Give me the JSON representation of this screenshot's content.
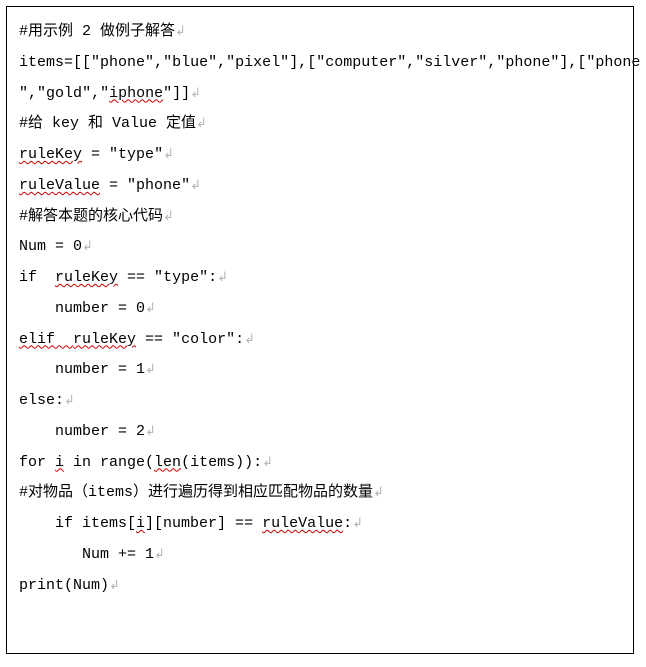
{
  "code": {
    "l1_comment": "#用示例 2 做例子解答",
    "l2_a": "items=[[",
    "l2_q": "\"",
    "l2_phone": "phone",
    "l2_comma": ",",
    "l2_blue": "blue",
    "l2_pixel": "pixel",
    "l2_b": "],[",
    "l2_computer": "computer",
    "l2_silver": "silver",
    "l2_phone2": "phone",
    "l2_c": "],[",
    "l2_phone3": "phone",
    "l3_a": "\"",
    "l3_gold": "gold",
    "l3_iphone": "iphone",
    "l3_b": "]]",
    "l4_comment": "#给 key 和 Value 定值",
    "l5_rk": "ruleKey",
    "l5_eq": " = ",
    "l5_type": "type",
    "l6_rv": "ruleValue",
    "l6_eq": " = ",
    "l6_phone": "phone",
    "l7_comment": "#解答本题的核心代码",
    "l8": "Num = 0",
    "l9_if": "if  ",
    "l9_rk": "ruleKey",
    "l9_eq": " == ",
    "l9_type": "type",
    "l9_colon": ":",
    "l10": "    number = 0",
    "l11_elif": "elif  ",
    "l11_rk": "ruleKey",
    "l11_eq": " == ",
    "l11_color": "color",
    "l11_colon": ":",
    "l12": "    number = 1",
    "l13": "else:",
    "l14": "    number = 2",
    "l15_a": "for ",
    "l15_i": "i",
    "l15_b": " in range(",
    "l15_len": "len",
    "l15_c": "(items)):",
    "l16_comment": "#对物品（items）进行遍历得到相应匹配物品的数量",
    "l17_a": "    if items[",
    "l17_i": "i",
    "l17_b": "][number] == ",
    "l17_rv": "ruleValue",
    "l17_c": ":",
    "l18": "       Num += 1",
    "l19": "print(Num)"
  },
  "glyph": {
    "ret": "↲"
  }
}
